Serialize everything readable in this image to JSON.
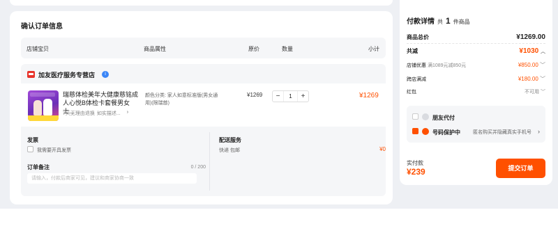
{
  "order": {
    "title": "确认订单信息",
    "headers": [
      "店铺宝贝",
      "商品属性",
      "原价",
      "数量",
      "小计"
    ],
    "shop": {
      "name": "加友医疗服务专营店",
      "badge": "i"
    },
    "item": {
      "title": "瑞慈体检美年大健康慈铭成人心悦B体检卡套餐男女士...",
      "service": "7天无理由退换",
      "service_more": "如实描述...",
      "chevron": "›",
      "attr": "颜色分类: 家人如意标准版(男女通用)(限瑞慈)",
      "price": "¥1269",
      "qty_minus": "−",
      "qty": "1",
      "qty_plus": "+",
      "subtotal": "¥1269"
    },
    "invoice": {
      "title": "发票",
      "option": "我需要开具发票"
    },
    "note": {
      "title": "订单备注",
      "count": "0 / 200",
      "placeholder": "请输入，付款后商家可见，建议和商家协商一致"
    },
    "delivery": {
      "title": "配送服务",
      "method": "快递 包邮",
      "price": "¥0"
    }
  },
  "summary": {
    "title": "付款详情",
    "count_prefix": "共",
    "count": "1",
    "count_suffix": "件商品",
    "rows": [
      {
        "label": "商品总价",
        "value": "¥1269.00"
      },
      {
        "label": "共减",
        "value": "¥1030"
      },
      {
        "label": "店铺优惠",
        "note": "满1089元减850元",
        "value": "¥850.00"
      },
      {
        "label": "跨店满减",
        "value": "¥180.00"
      },
      {
        "label": "红包",
        "value": "不可用"
      }
    ],
    "promo": {
      "friend_pay": "朋友代付",
      "privacy": "号码保护中",
      "privacy_desc": "匿名购买并隐藏真实手机号",
      "chevron": "›"
    },
    "pay_label": "实付款",
    "pay_amount": "¥239",
    "submit": "提交订单"
  },
  "colors": {
    "accent": "#ff5000",
    "badge_blue": "#3b86f7",
    "shop_red": "#e8332a"
  }
}
